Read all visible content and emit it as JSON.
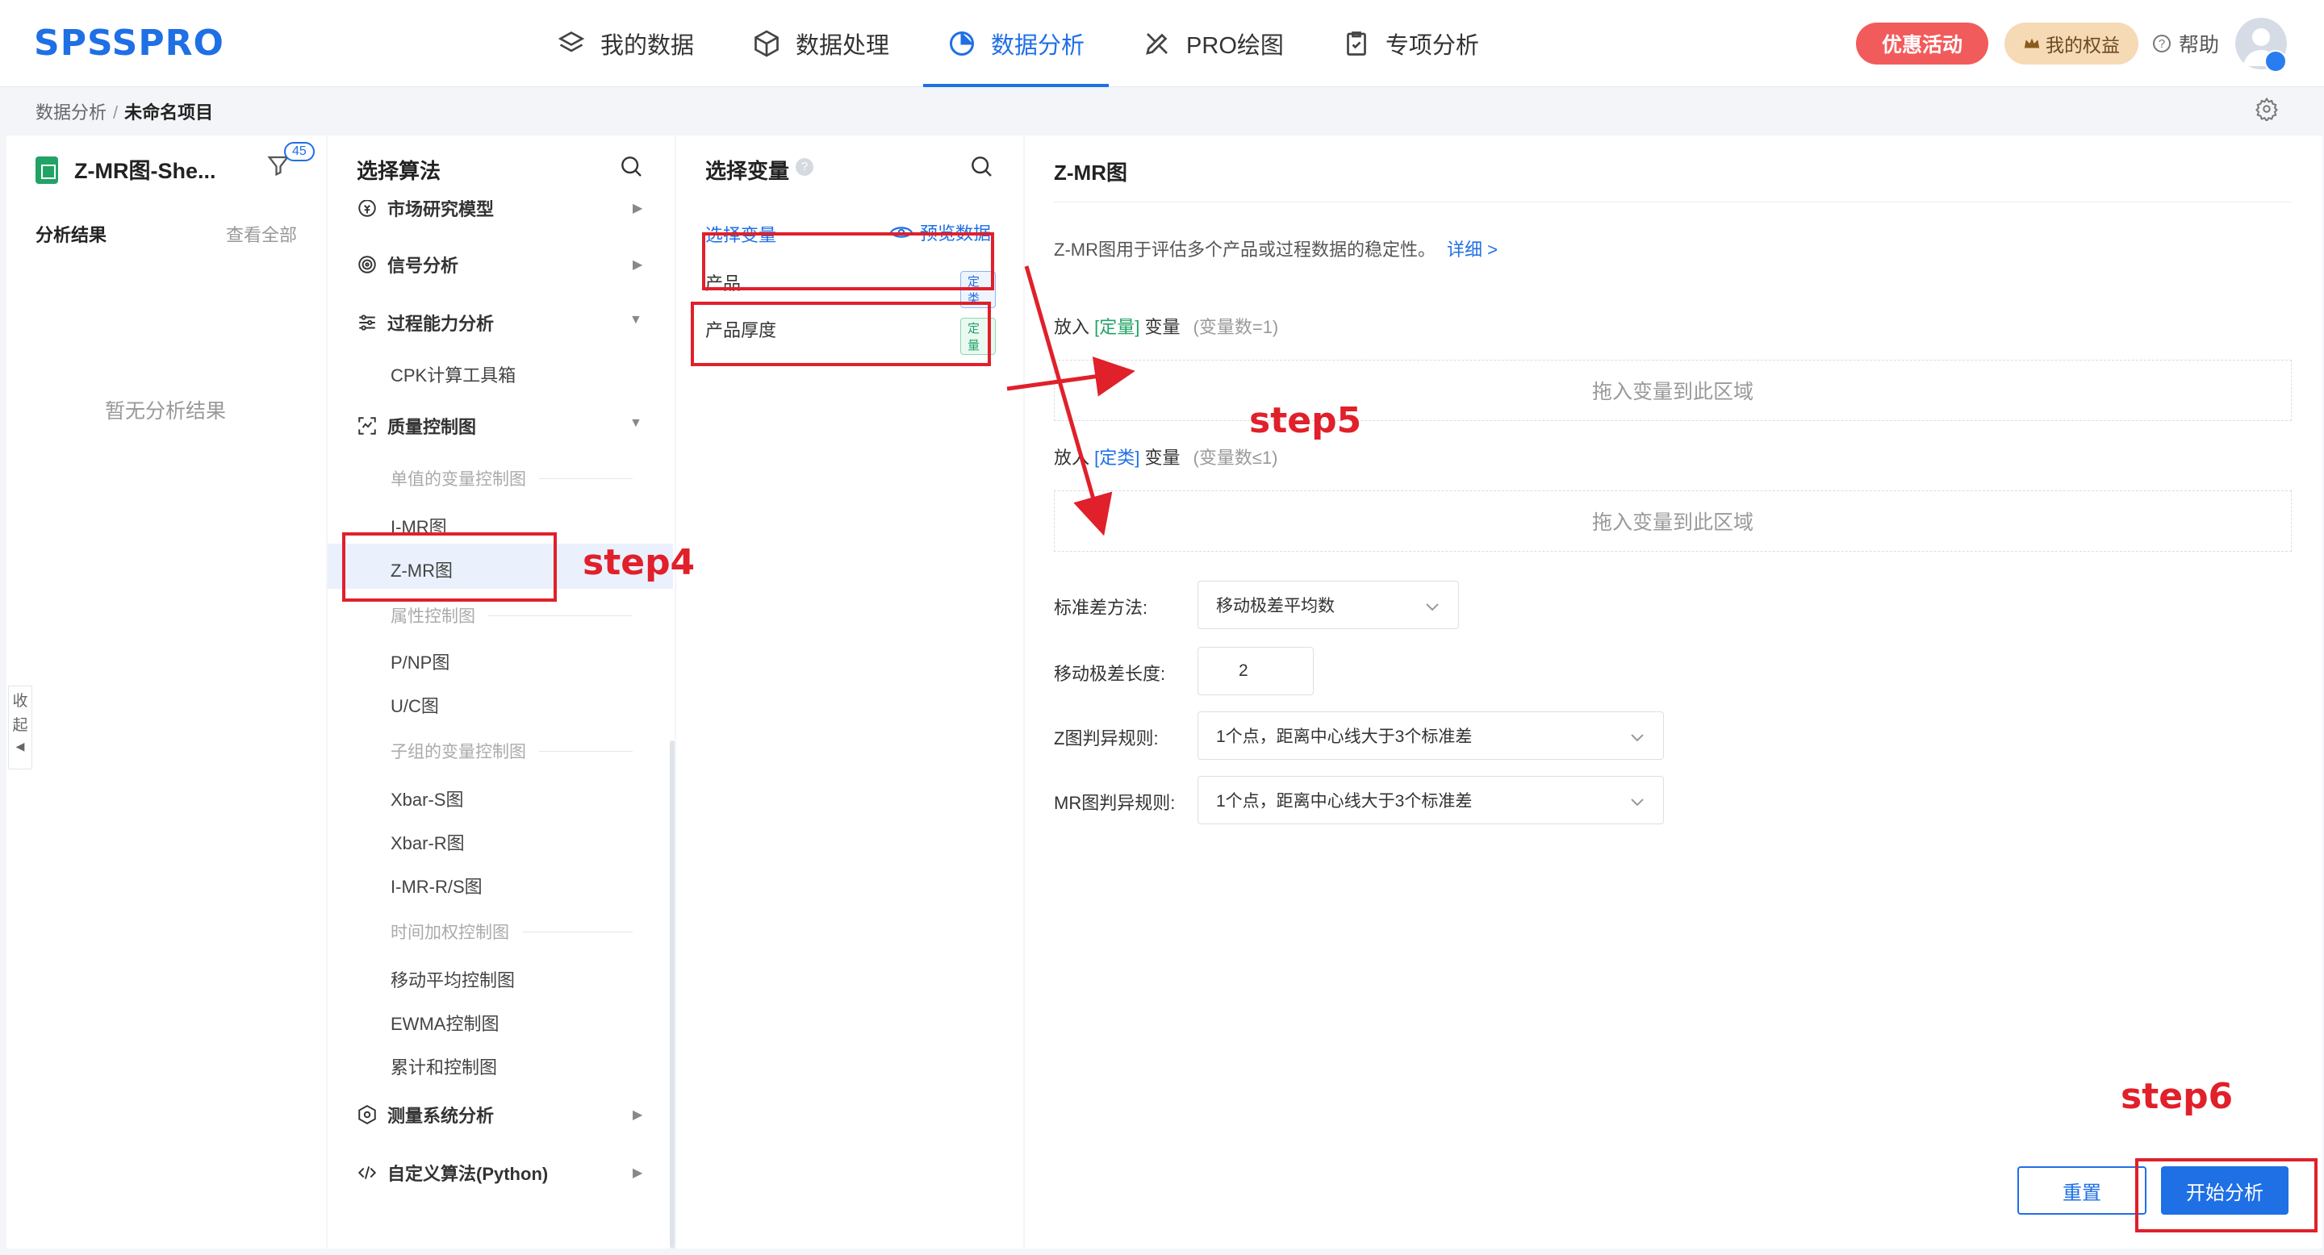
{
  "app": {
    "logo": "SPSSPRO"
  },
  "nav": {
    "tabs": [
      {
        "label": "我的数据",
        "icon": "layers-icon"
      },
      {
        "label": "数据处理",
        "icon": "cube-icon"
      },
      {
        "label": "数据分析",
        "icon": "pie-chart-icon"
      },
      {
        "label": "PRO绘图",
        "icon": "draw-icon"
      },
      {
        "label": "专项分析",
        "icon": "clipboard-icon"
      }
    ],
    "active_tab": "数据分析",
    "promo": "优惠活动",
    "rights": "我的权益",
    "help": "帮助"
  },
  "breadcrumb": {
    "parent": "数据分析",
    "separator": "/",
    "current": "未命名项目"
  },
  "left_panel": {
    "sheet_name": "Z-MR图-She...",
    "filter_count": "45",
    "results_title": "分析结果",
    "view_all": "查看全部",
    "empty": "暂无分析结果",
    "collapse": [
      "收",
      "起"
    ]
  },
  "algo_panel": {
    "title": "选择算法",
    "categories": {
      "market": "市场研究模型",
      "signal": "信号分析",
      "capability": "过程能力分析",
      "capability_items": [
        "CPK计算工具箱"
      ],
      "quality": "质量控制图",
      "measure": "测量系统分析",
      "custom": "自定义算法(Python)"
    },
    "quality_sub": {
      "single": "单值的变量控制图",
      "attribute": "属性控制图",
      "subgroup": "子组的变量控制图",
      "timeweighted": "时间加权控制图"
    },
    "quality_items": {
      "imr": "I-MR图",
      "zmr": "Z-MR图",
      "pnp": "P/NP图",
      "uc": "U/C图",
      "xbars": "Xbar-S图",
      "xbarr": "Xbar-R图",
      "imrrs": "I-MR-R/S图",
      "ma": "移动平均控制图",
      "ewma": "EWMA控制图",
      "cusum": "累计和控制图"
    },
    "selected": "Z-MR图"
  },
  "var_panel": {
    "title": "选择变量",
    "tab": "选择变量",
    "preview": "预览数据",
    "variables": [
      {
        "name": "产品",
        "type": "定类"
      },
      {
        "name": "产品厚度",
        "type": "定量"
      }
    ]
  },
  "config_panel": {
    "title": "Z-MR图",
    "description": "Z-MR图用于评估多个产品或过程数据的稳定性。",
    "detail_link": "详细 >",
    "slot1": {
      "prefix": "放入",
      "type": "[定量]",
      "suffix": "变量",
      "hint": "(变量数=1)"
    },
    "slot2": {
      "prefix": "放入",
      "type": "[定类]",
      "suffix": "变量",
      "hint": "(变量数≤1)"
    },
    "dropzone_text": "拖入变量到此区域",
    "fields": {
      "std_method_label": "标准差方法:",
      "std_method_value": "移动极差平均数",
      "mr_length_label": "移动极差长度:",
      "mr_length_value": "2",
      "z_rule_label": "Z图判异规则:",
      "z_rule_value": "1个点，距离中心线大于3个标准差",
      "mr_rule_label": "MR图判异规则:",
      "mr_rule_value": "1个点，距离中心线大于3个标准差"
    },
    "reset": "重置",
    "start": "开始分析"
  },
  "annotations": {
    "step4": "step4",
    "step5": "step5",
    "step6": "step6",
    "color": "#e0202a"
  },
  "colors": {
    "accent": "#1f6fe5",
    "promo": "#f25b5b",
    "qty_green": "#21a366"
  }
}
